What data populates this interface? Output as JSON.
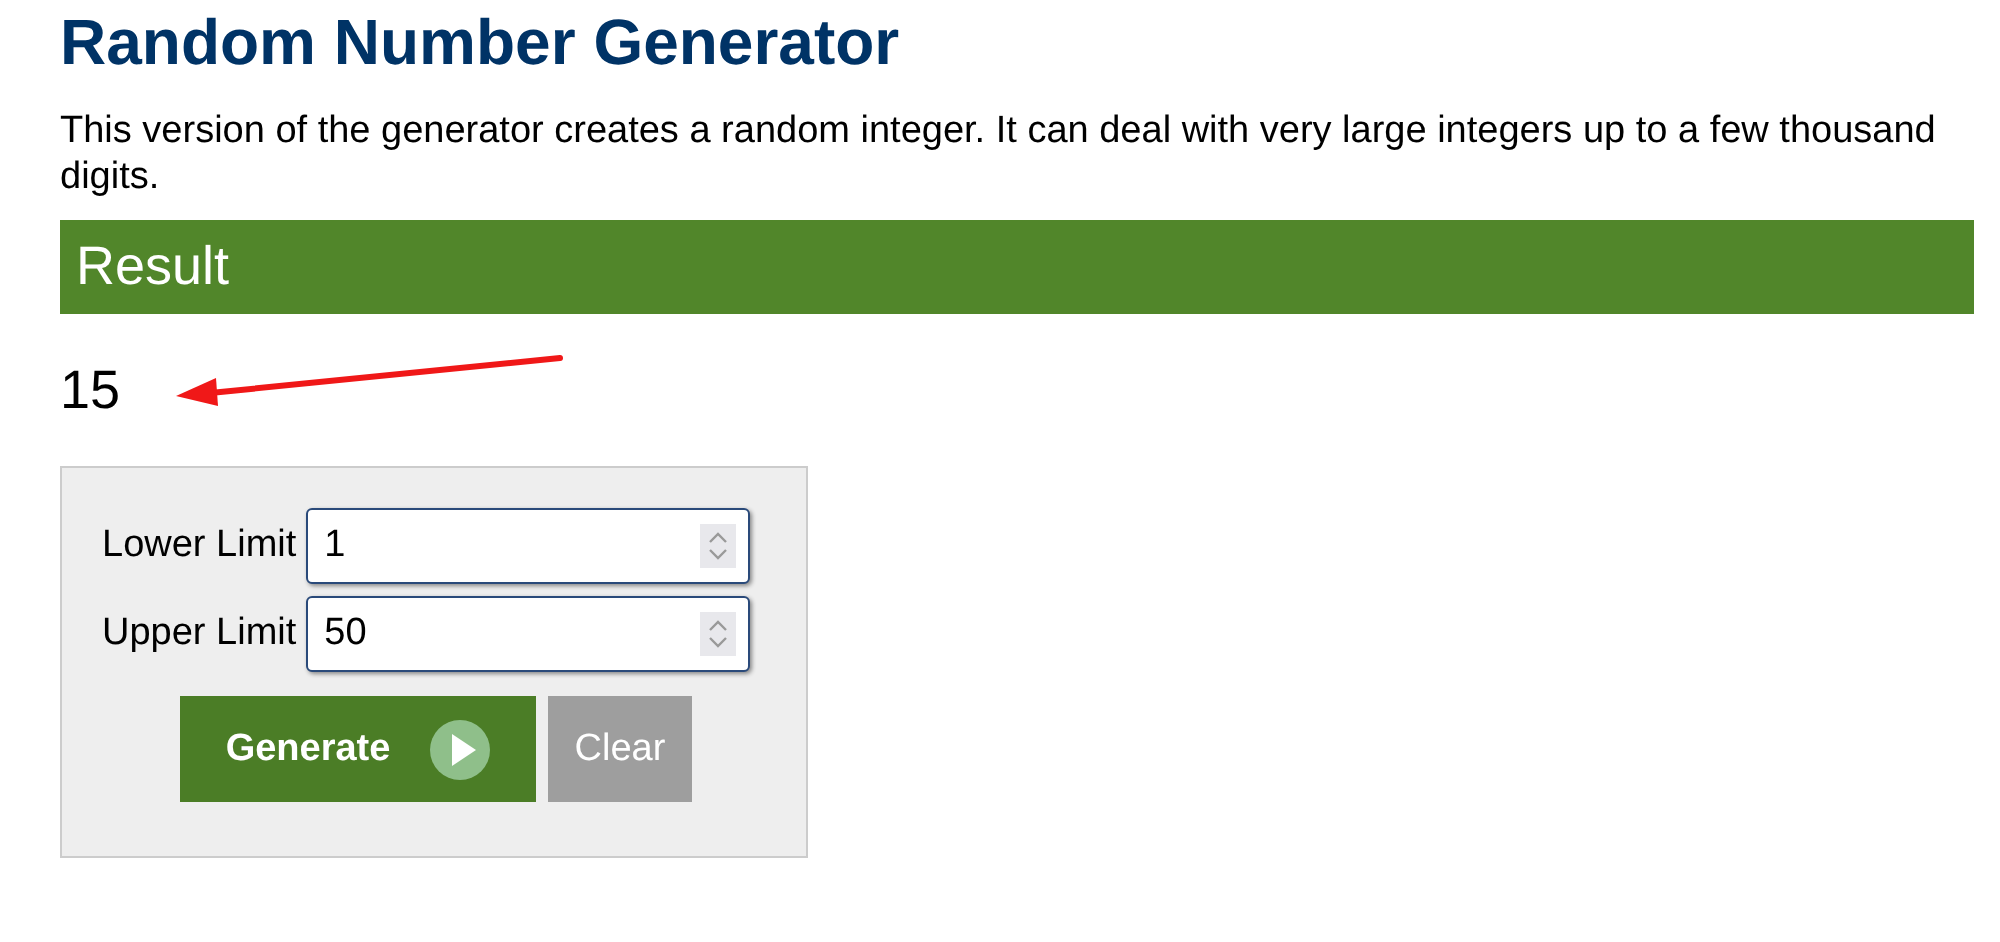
{
  "title": "Random Number Generator",
  "description": "This version of the generator creates a random integer. It can deal with very large integers up to a few thousand digits.",
  "result": {
    "heading": "Result",
    "value": "15"
  },
  "form": {
    "fields": [
      {
        "label": "Lower Limit",
        "value": "1"
      },
      {
        "label": "Upper Limit",
        "value": "50"
      }
    ],
    "buttons": [
      {
        "label": "Generate",
        "kind": "primary"
      },
      {
        "label": "Clear",
        "kind": "secondary"
      }
    ]
  }
}
